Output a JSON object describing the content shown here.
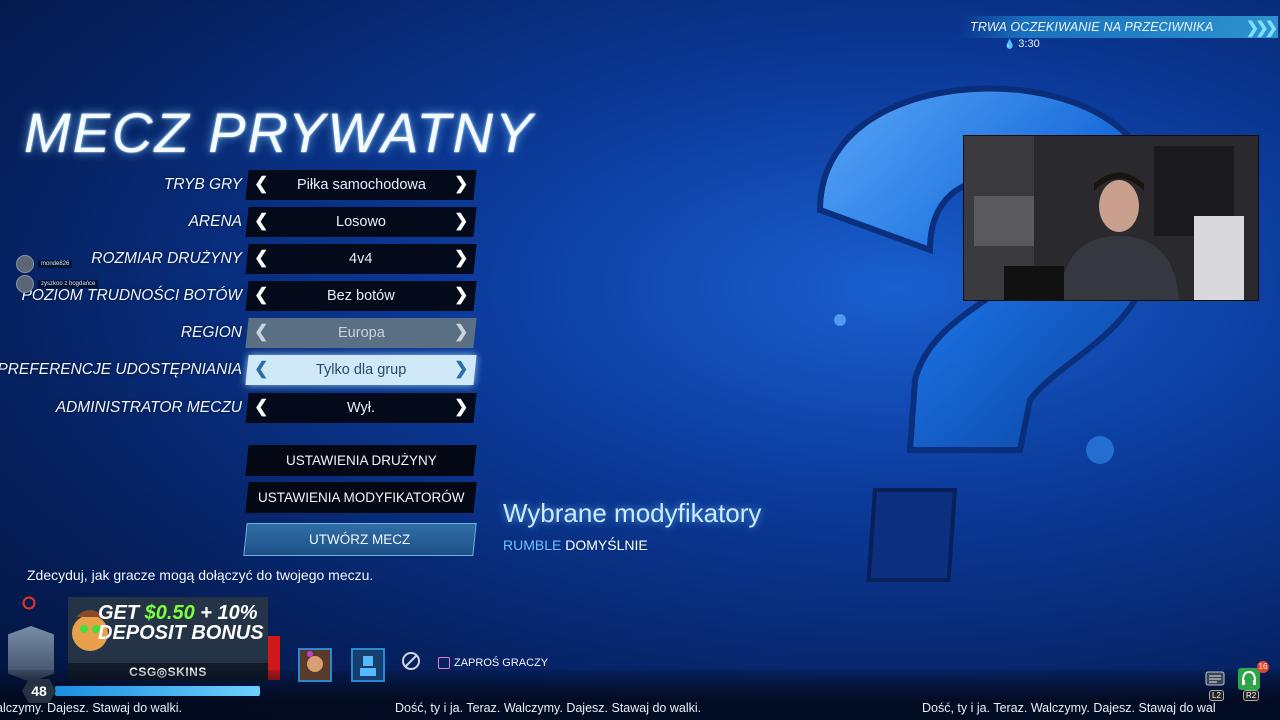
{
  "status": {
    "text": "TRWA OCZEKIWANIE NA PRZECIWNIKA",
    "timer": "3:30"
  },
  "title": "MECZ PRYWATNY",
  "settings": [
    {
      "label": "TRYB GRY",
      "value": "Piłka samochodowa",
      "state": "normal"
    },
    {
      "label": "ARENA",
      "value": "Losowo",
      "state": "normal"
    },
    {
      "label": "ROZMIAR DRUŻYNY",
      "value": "4v4",
      "state": "normal"
    },
    {
      "label": "POZIOM TRUDNOŚCI BOTÓW",
      "value": "Bez botów",
      "state": "normal"
    },
    {
      "label": "REGION",
      "value": "Europa",
      "state": "disabled"
    },
    {
      "label": "PREFERENCJE UDOSTĘPNIANIA",
      "value": "Tylko dla grup",
      "state": "focused"
    },
    {
      "label": "ADMINISTRATOR MECZU",
      "value": "Wył.",
      "state": "normal"
    }
  ],
  "arrows": {
    "left": "❮",
    "right": "❯"
  },
  "actions": {
    "team_settings": "USTAWIENIA DRUŻYNY",
    "modifier_settings": "USTAWIENIA MODYFIKATORÓW",
    "create_match": "UTWÓRZ MECZ"
  },
  "hint": "Zdecyduj, jak gracze mogą dołączyć do twojego meczu.",
  "modifiers": {
    "title": "Wybrane modyfikatory",
    "key": "RUMBLE",
    "value": "DOMYŚLNIE"
  },
  "chat": [
    {
      "text": "monde826"
    },
    {
      "text": "zyszkoo z bogdańce"
    }
  ],
  "ad": {
    "line1_prefix": "GET ",
    "line1_amount": "$0.50",
    "line1_suffix": " + 10%",
    "line2": "DEPOSIT BONUS",
    "brand": "CSG◎SKINS"
  },
  "player": {
    "level": "48"
  },
  "invite_label": "ZAPROŚ GRACZY",
  "ticker": "Dość, ty i ja. Teraz. Walczymy. Dajesz. Stawaj do walki.",
  "ticker_left": "alczymy. Dajesz. Stawaj do walki.",
  "ticker_right": "Dość, ty i ja. Teraz. Walczymy. Dajesz. Stawaj do wal",
  "button_hints": {
    "l2": "L2",
    "r2": "R2"
  },
  "notification_count": "16",
  "colors": {
    "accent": "#2c86d0",
    "focus": "#cfe9f8",
    "ad_green": "#7dff3a"
  }
}
